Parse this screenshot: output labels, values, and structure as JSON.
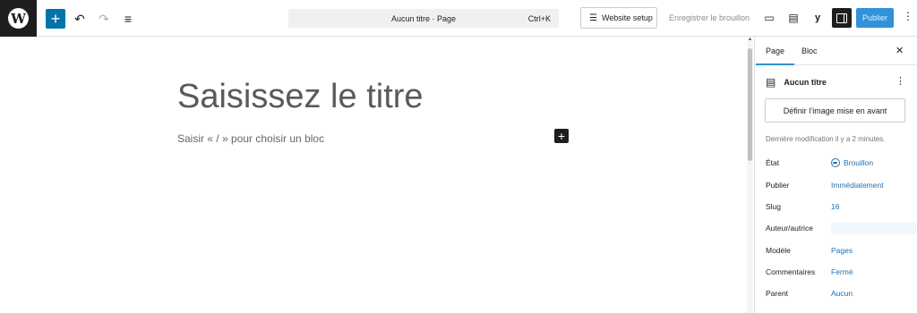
{
  "toolbar": {
    "wp_logo": "W",
    "add_block": "+",
    "undo_icon": "↶",
    "redo_icon": "↷",
    "list_view_icon": "≡",
    "command": {
      "title": "Aucun titre · Page",
      "shortcut": "Ctrl+K"
    },
    "website_setup": "Website setup",
    "website_setup_icon": "☰",
    "save_draft": "Enregistrer le brouillon",
    "preview_icon": "▭",
    "doc_icon": "▤",
    "yoast": "y",
    "publish": "Publier",
    "more_icon": "⋮"
  },
  "editor": {
    "title_placeholder": "Saisissez le titre",
    "block_hint": "Saisir « / » pour choisir un bloc",
    "block_add": "+"
  },
  "sidebar": {
    "tabs": [
      {
        "label": "Page",
        "active": true
      },
      {
        "label": "Bloc",
        "active": false
      }
    ],
    "close_icon": "✕",
    "doc_icon": "▤",
    "doc_title": "Aucun titre",
    "doc_more": "⋮",
    "featured_image_button": "Définir l’image mise en avant",
    "last_modified": "Dernière modification il y a 2 minutes.",
    "rows": [
      {
        "key": "État",
        "value": "Brouillon"
      },
      {
        "key": "Publier",
        "value": "Immédiatement"
      },
      {
        "key": "Slug",
        "value": "16"
      },
      {
        "key": "Auteur/autrice",
        "value": ""
      },
      {
        "key": "Modèle",
        "value": "Pages"
      },
      {
        "key": "Commentaires",
        "value": "Fermé"
      },
      {
        "key": "Parent",
        "value": "Aucun"
      }
    ]
  },
  "colors": {
    "accent": "#3092d9",
    "link": "#2271b1",
    "dark": "#1e1e1e"
  }
}
